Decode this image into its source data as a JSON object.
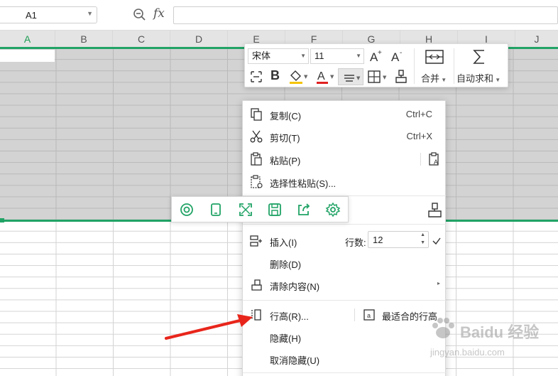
{
  "formula_bar": {
    "name_box_value": "A1",
    "fx_label": "fx",
    "formula_value": ""
  },
  "columns": [
    "A",
    "B",
    "C",
    "D",
    "E",
    "F",
    "G",
    "H",
    "I",
    "J"
  ],
  "format_toolbar": {
    "font_name": "宋体",
    "font_size": "11",
    "bold_label": "B",
    "font_color_label": "A",
    "merge_label": "合并",
    "autosum_label": "自动求和",
    "colors": {
      "fill": "#f5c400",
      "font": "#e02020",
      "accent": "#21a366"
    }
  },
  "context_menu": {
    "items": [
      {
        "icon": "copy-icon",
        "label": "复制(C)",
        "shortcut": "Ctrl+C"
      },
      {
        "icon": "cut-icon",
        "label": "剪切(T)",
        "shortcut": "Ctrl+X"
      },
      {
        "icon": "paste-icon",
        "label": "粘贴(P)",
        "shortcut": ""
      },
      {
        "icon": "paste-special-icon",
        "label": "选择性粘贴(S)...",
        "shortcut": ""
      },
      {
        "icon": "insert-row-icon",
        "label": "插入(I)",
        "shortcut": ""
      },
      {
        "icon": "",
        "label": "删除(D)",
        "shortcut": ""
      },
      {
        "icon": "eraser-icon",
        "label": "清除内容(N)",
        "shortcut": ""
      },
      {
        "icon": "row-height-icon",
        "label": "行高(R)...",
        "shortcut": ""
      },
      {
        "icon": "",
        "label": "隐藏(H)",
        "shortcut": ""
      },
      {
        "icon": "",
        "label": "取消隐藏(U)",
        "shortcut": ""
      }
    ],
    "row_count_label": "行数:",
    "row_count_value": "12",
    "best_fit_label": "最适合的行高"
  },
  "icon_strip": [
    "at-icon",
    "tablet-icon",
    "expand-icon",
    "save-icon",
    "share-icon",
    "settings-icon"
  ],
  "watermark": {
    "brand_text": "Baidu 经验",
    "url_text": "jingyan.baidu.com"
  }
}
